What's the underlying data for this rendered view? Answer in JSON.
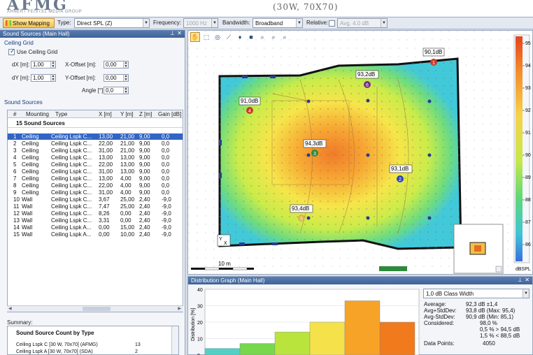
{
  "header": {
    "logo": "AFMG",
    "logo_sub": "AHNERT FEISTEL MEDIA GROUP",
    "doc_subtitle": "(30W, 70X70)"
  },
  "toolbar": {
    "show_mapping": "Show Mapping",
    "type_label": "Type:",
    "type_value": "Direct SPL (Z)",
    "frequency_label": "Frequency:",
    "frequency_value": "1000 Hz",
    "bandwidth_label": "Bandwidth:",
    "bandwidth_value": "Broadband",
    "relative_label": "Relative:",
    "relative_value": "Avg. 4.0 dB"
  },
  "left_panel": {
    "title": "Sound Sources (Main Hall)",
    "ceiling_grid_label": "Ceiling Grid",
    "use_ceiling_grid": "Use Ceiling Grid",
    "dx_label": "dX [m]:",
    "dx_value": "1,00",
    "dy_label": "dY [m]:",
    "dy_value": "1,00",
    "xoffset_label": "X-Offset [m]:",
    "xoffset_value": "0,00",
    "yoffset_label": "Y-Offset [m]:",
    "yoffset_value": "0,00",
    "angle_label": "Angle [°]:",
    "angle_value": "0,0",
    "sources_label": "Sound Sources",
    "columns": [
      "#",
      "Mounting",
      "Type",
      "X [m]",
      "Y [m]",
      "Z [m]",
      "Gain [dB]"
    ],
    "group_label": "15 Sound Sources",
    "rows": [
      [
        "1",
        "Ceiling",
        "Ceiling Lspk C...",
        "13,00",
        "21,00",
        "9,00",
        "0,0"
      ],
      [
        "2",
        "Ceiling",
        "Ceiling Lspk C...",
        "22,00",
        "21,00",
        "9,00",
        "0,0"
      ],
      [
        "3",
        "Ceiling",
        "Ceiling Lspk C...",
        "31,00",
        "21,00",
        "9,00",
        "0,0"
      ],
      [
        "4",
        "Ceiling",
        "Ceiling Lspk C...",
        "13,00",
        "13,00",
        "9,00",
        "0,0"
      ],
      [
        "5",
        "Ceiling",
        "Ceiling Lspk C...",
        "22,00",
        "13,00",
        "9,00",
        "0,0"
      ],
      [
        "6",
        "Ceiling",
        "Ceiling Lspk C...",
        "31,00",
        "13,00",
        "9,00",
        "0,0"
      ],
      [
        "7",
        "Ceiling",
        "Ceiling Lspk C...",
        "13,00",
        "4,00",
        "9,00",
        "0,0"
      ],
      [
        "8",
        "Ceiling",
        "Ceiling Lspk C...",
        "22,00",
        "4,00",
        "9,00",
        "0,0"
      ],
      [
        "9",
        "Ceiling",
        "Ceiling Lspk C...",
        "31,00",
        "4,00",
        "9,00",
        "0,0"
      ],
      [
        "10",
        "Wall",
        "Ceiling Lspk C...",
        "3,67",
        "25,00",
        "2,40",
        "-9,0"
      ],
      [
        "11",
        "Wall",
        "Ceiling Lspk C...",
        "7,47",
        "25,00",
        "2,40",
        "-9,0"
      ],
      [
        "12",
        "Wall",
        "Ceiling Lspk C...",
        "8,26",
        "0,00",
        "2,40",
        "-9,0"
      ],
      [
        "13",
        "Wall",
        "Ceiling Lspk C...",
        "3,31",
        "0,00",
        "2,40",
        "-9,0"
      ],
      [
        "14",
        "Wall",
        "Ceiling Lspk A...",
        "0,00",
        "15,00",
        "2,40",
        "-9,0"
      ],
      [
        "15",
        "Wall",
        "Ceiling Lspk A...",
        "0,00",
        "10,00",
        "2,40",
        "-9,0"
      ]
    ],
    "summary_label": "Summary:",
    "summary_title": "Sound Source Count by Type",
    "summary_rows": [
      {
        "name": "Ceiling Lspk C [30 W, 70x70] (AFMG)",
        "count": "13"
      },
      {
        "name": "Ceiling Lspk A [30 W, 70x70] (SDA)",
        "count": "2"
      }
    ]
  },
  "map": {
    "scale_label": "10 m",
    "axis_label": "X",
    "axis_label_y": "Y",
    "colorbar_unit": "dBSPL",
    "colorbar_ticks": [
      "95",
      "94",
      "93",
      "92",
      "91",
      "90",
      "89",
      "88",
      "87",
      "86"
    ],
    "markers": [
      {
        "num": "1",
        "label": "90,1dB",
        "color": "#c93a2a"
      },
      {
        "num": "2",
        "label": "93,1dB",
        "color": "#2d48b8"
      },
      {
        "num": "3",
        "label": "94,3dB",
        "color": "#2e8b3a"
      },
      {
        "num": "4",
        "label": "91,0dB",
        "color": "#c93a2a"
      },
      {
        "num": "5",
        "label": "93,4dB",
        "color": "#d9b24a"
      },
      {
        "num": "6",
        "label": "93,2dB",
        "color": "#7b2a8c"
      }
    ]
  },
  "distribution": {
    "title": "Distribution Graph (Main Hall)",
    "class_width": "1,0 dB Class Width",
    "ylabel": "Distribution [%]",
    "stats": [
      {
        "k": "Average:",
        "v": "92,3 dB ±1,4",
        "v2": ""
      },
      {
        "k": "Avg+StdDev:",
        "v": "93,8 dB (Max: 95,4)",
        "v2": ""
      },
      {
        "k": "Avg-StdDev:",
        "v": "90,9 dB (Min: 85,1)",
        "v2": ""
      },
      {
        "k": "Considered:",
        "v": "98,0 %",
        "v2": ""
      },
      {
        "k": "",
        "v": "0,5 % > 94,5 dB",
        "v2": ""
      },
      {
        "k": "",
        "v": "1,5 % < 88,5 dB",
        "v2": ""
      },
      {
        "k": "Data Points:",
        "v": "4050",
        "v2": ""
      }
    ]
  },
  "chart_data": {
    "type": "bar",
    "ylabel": "Distribution [%]",
    "ylim": [
      0,
      40
    ],
    "yticks": [
      "40",
      "30",
      "20",
      "10",
      "0"
    ],
    "values": [
      4,
      7,
      14,
      20,
      33,
      20
    ],
    "colors": [
      "#4fd1c8",
      "#76d84a",
      "#b9e43c",
      "#f5e24a",
      "#f7a327",
      "#f07a1c"
    ]
  }
}
